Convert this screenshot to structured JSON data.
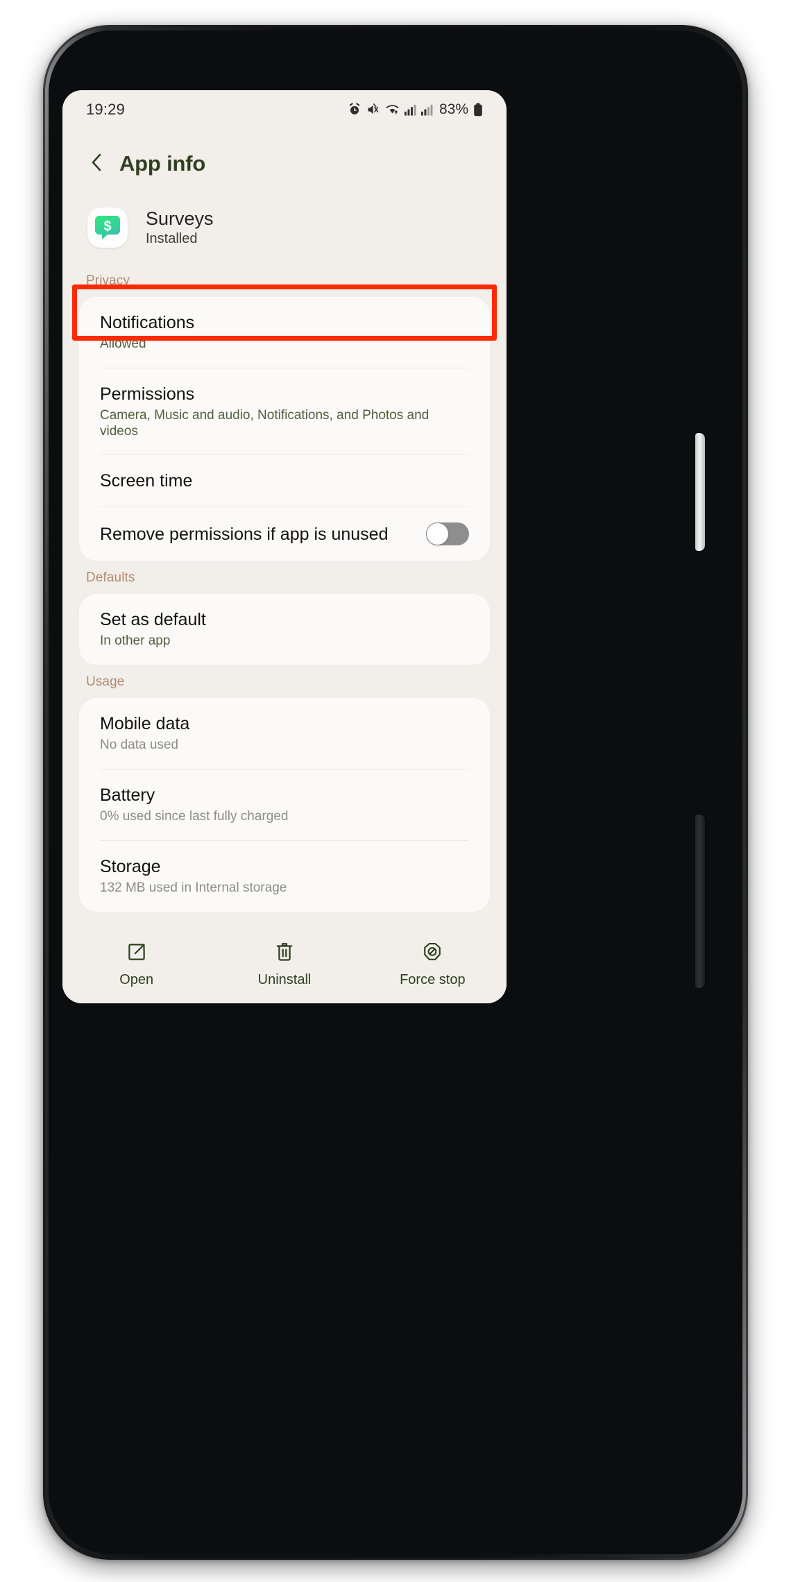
{
  "status_bar": {
    "time": "19:29",
    "battery_percent": "83%",
    "icons": [
      "alarm-icon",
      "mute-vibrate-icon",
      "wifi-icon",
      "signal-sim1-icon",
      "signal-sim2-icon",
      "battery-icon"
    ]
  },
  "app_bar": {
    "back_icon": "chevron-left-icon",
    "title": "App info"
  },
  "app_identity": {
    "icon": "surveys-app-icon",
    "name": "Surveys",
    "status": "Installed"
  },
  "sections": [
    {
      "header": "Privacy",
      "rows": [
        {
          "title": "Notifications",
          "subtitle": "Allowed",
          "subtitle_style": "green",
          "type": "link"
        },
        {
          "title": "Permissions",
          "subtitle": "Camera, Music and audio, Notifications, and Photos and videos",
          "subtitle_style": "green",
          "type": "link",
          "highlighted": true
        },
        {
          "title": "Screen time",
          "subtitle": "",
          "subtitle_style": "green",
          "type": "link"
        },
        {
          "title": "Remove permissions if app is unused",
          "subtitle": "",
          "subtitle_style": "green",
          "type": "toggle",
          "toggle_on": false
        }
      ]
    },
    {
      "header": "Defaults",
      "rows": [
        {
          "title": "Set as default",
          "subtitle": "In other app",
          "subtitle_style": "green",
          "type": "link"
        }
      ]
    },
    {
      "header": "Usage",
      "rows": [
        {
          "title": "Mobile data",
          "subtitle": "No data used",
          "subtitle_style": "gray",
          "type": "link"
        },
        {
          "title": "Battery",
          "subtitle": "0% used since last fully charged",
          "subtitle_style": "gray",
          "type": "link"
        },
        {
          "title": "Storage",
          "subtitle": "132 MB used in Internal storage",
          "subtitle_style": "gray",
          "type": "link"
        }
      ]
    }
  ],
  "action_bar": [
    {
      "icon": "open-external-icon",
      "label": "Open"
    },
    {
      "icon": "trash-icon",
      "label": "Uninstall"
    },
    {
      "icon": "force-stop-icon",
      "label": "Force stop"
    }
  ],
  "annotation": {
    "target": "Permissions",
    "color": "#fb2b06"
  },
  "colors": {
    "screen_background": "#f2efeb",
    "card_background": "#fbfaf9",
    "accent_green": "#2e4020",
    "section_header": "#b08a6e",
    "subtitle_green": "#51603c",
    "subtitle_gray": "#8c8c8c",
    "toggle_off": "#8e8e8e"
  }
}
